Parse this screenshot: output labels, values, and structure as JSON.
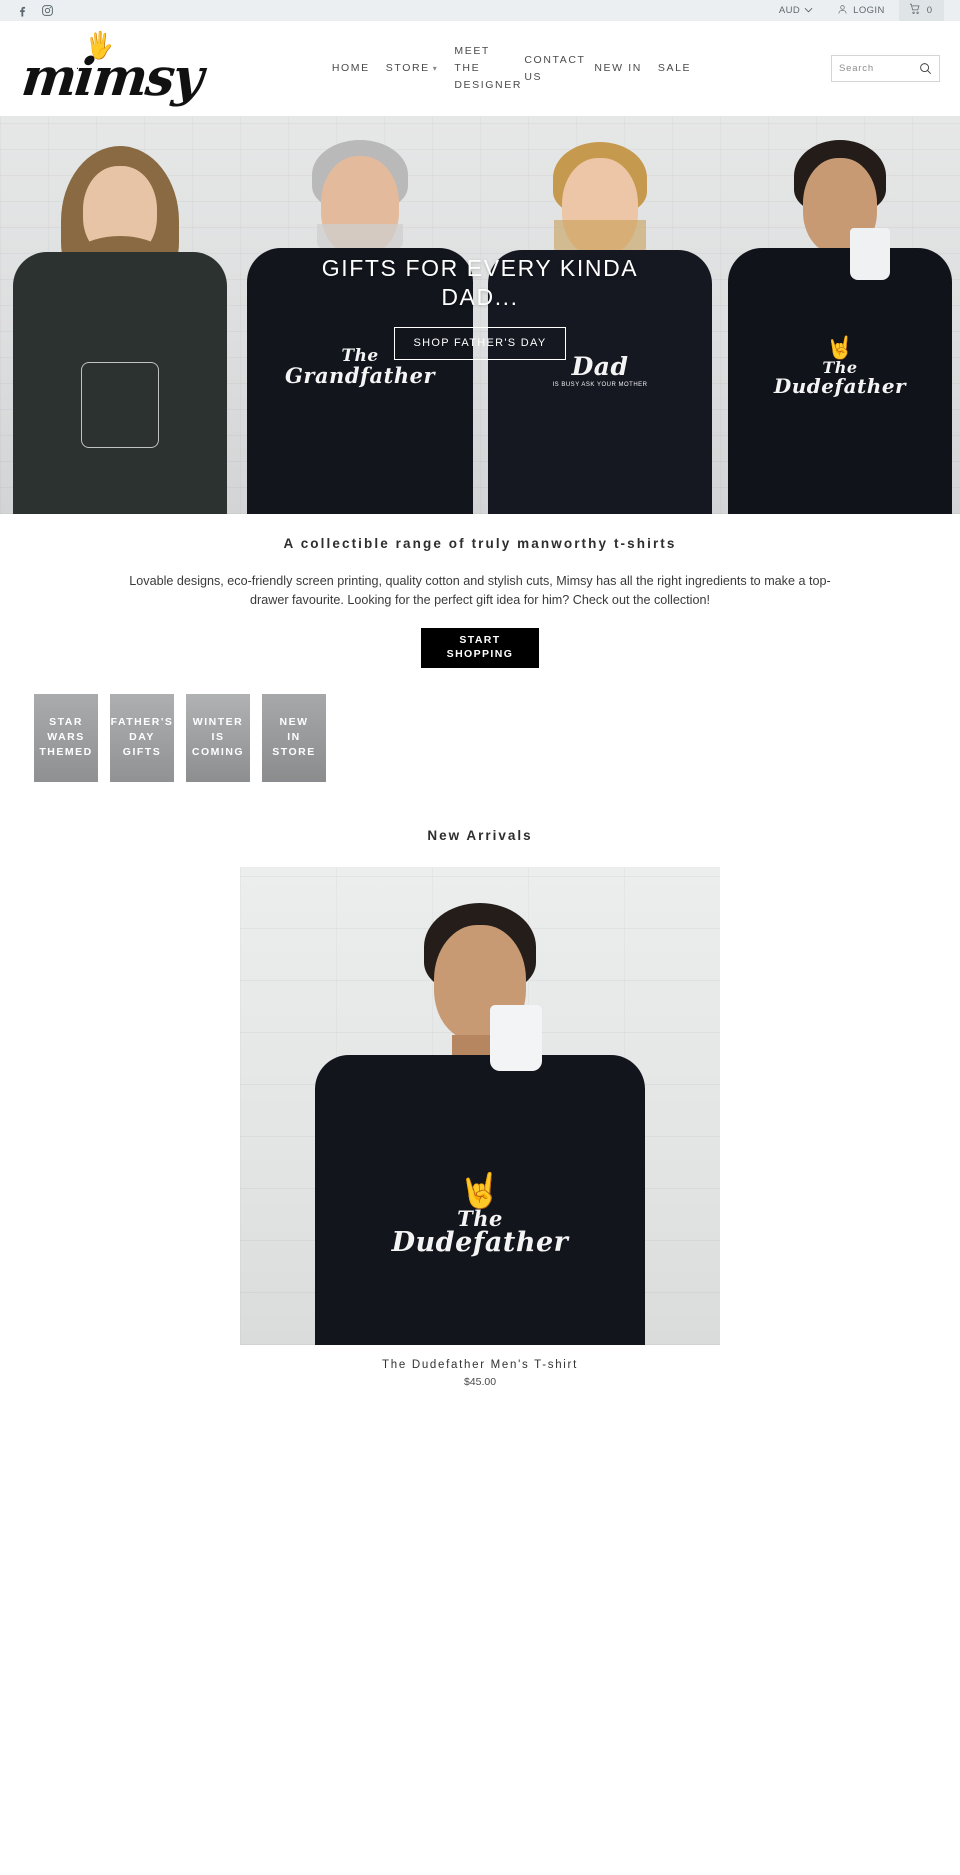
{
  "topbar": {
    "social": [
      {
        "name": "facebook-icon",
        "label": "Facebook"
      },
      {
        "name": "instagram-icon",
        "label": "Instagram"
      }
    ],
    "currency": "AUD",
    "currency_caret": "⌄",
    "login_label": "LOGIN",
    "cart_count": "0"
  },
  "header": {
    "logo_text": "mimsy",
    "nav": [
      {
        "label": "HOME",
        "caret": false
      },
      {
        "label": "STORE",
        "caret": true
      },
      {
        "label": "MEET THE DESIGNER",
        "caret": false
      },
      {
        "label": "CONTACT US",
        "caret": false
      },
      {
        "label": "NEW IN",
        "caret": false
      },
      {
        "label": "SALE",
        "caret": false
      }
    ],
    "search": {
      "placeholder": "Search",
      "value": ""
    }
  },
  "hero": {
    "title": "GIFTS FOR EVERY KINDA DAD...",
    "button": "SHOP FATHER'S DAY",
    "shirts": [
      {
        "line1": "",
        "line2": "",
        "art": "trooper"
      },
      {
        "line1": "The",
        "line2": "Grandfather",
        "art": "text"
      },
      {
        "line1": "Dad",
        "line2": "IS BUSY ASK YOUR MOTHER",
        "art": "text"
      },
      {
        "line1": "The",
        "line2": "Dudefather",
        "art": "text"
      }
    ]
  },
  "intro": {
    "heading": "A collectible range of truly manworthy t-shirts",
    "body": "Lovable designs, eco-friendly screen printing, quality cotton and stylish cuts, Mimsy has all the right ingredients to make a top-drawer favourite. Looking for the perfect gift idea for him? Check out the collection!",
    "button_line1": "START",
    "button_line2": "SHOPPING"
  },
  "tiles": [
    {
      "lines": [
        "STAR",
        "WARS",
        "THEMED"
      ]
    },
    {
      "lines": [
        "FATHER'S",
        "DAY",
        "GIFTS"
      ]
    },
    {
      "lines": [
        "WINTER",
        "IS",
        "COMING"
      ]
    },
    {
      "lines": [
        "NEW",
        "IN",
        "STORE"
      ]
    }
  ],
  "arrivals": {
    "heading": "New Arrivals",
    "products": [
      {
        "name": "The Dudefather Men's T-shirt",
        "price": "$45.00",
        "shirt_line1": "The",
        "shirt_line2": "Dudefather"
      }
    ]
  },
  "colors": {
    "topbar_bg": "#eceff1",
    "cart_bg": "#dfe4e7",
    "accent_black": "#000000",
    "text": "#2b2b2b"
  }
}
